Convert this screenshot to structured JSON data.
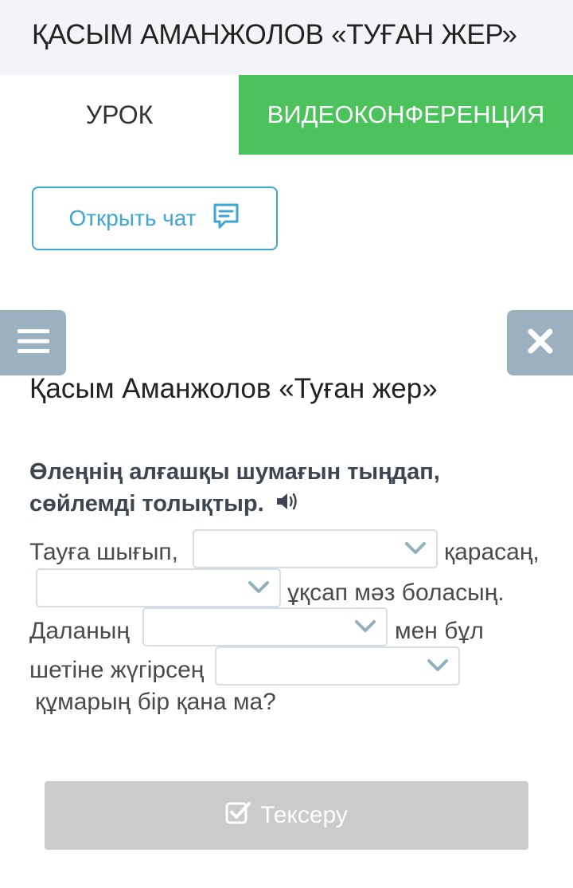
{
  "header": {
    "title": "ҚАСЫМ АМАНЖОЛОВ «ТУҒАН ЖЕР»"
  },
  "tabs": {
    "lesson": "УРОК",
    "video": "ВИДЕОКОНФЕРЕНЦИЯ"
  },
  "chat": {
    "label": "Открыть чат",
    "icon": "chat-icon"
  },
  "lesson": {
    "title": "Қасым Аманжолов «Туған жер»",
    "instruction": "Өлеңнің алғашқы шумағын тыңдап, сөйлемді толықтыр."
  },
  "exercise": {
    "line1_start": "Тауға шығып,",
    "line1_end": "қарасаң,",
    "line2_end": "ұқсап мәз боласың.",
    "line3_start": "Даланың",
    "line3_end": "мен бұл",
    "line4_start": "шетіне жүгірсең",
    "line5": "құмарың бір қана ма?",
    "dropdowns": [
      "",
      "",
      "",
      ""
    ]
  },
  "actions": {
    "check_label": "Тексеру"
  },
  "colors": {
    "accent_green": "#4cc25c",
    "accent_blue": "#3ea6d3",
    "side_button": "#9bb1bf",
    "disabled_button": "#cbcbcb"
  }
}
